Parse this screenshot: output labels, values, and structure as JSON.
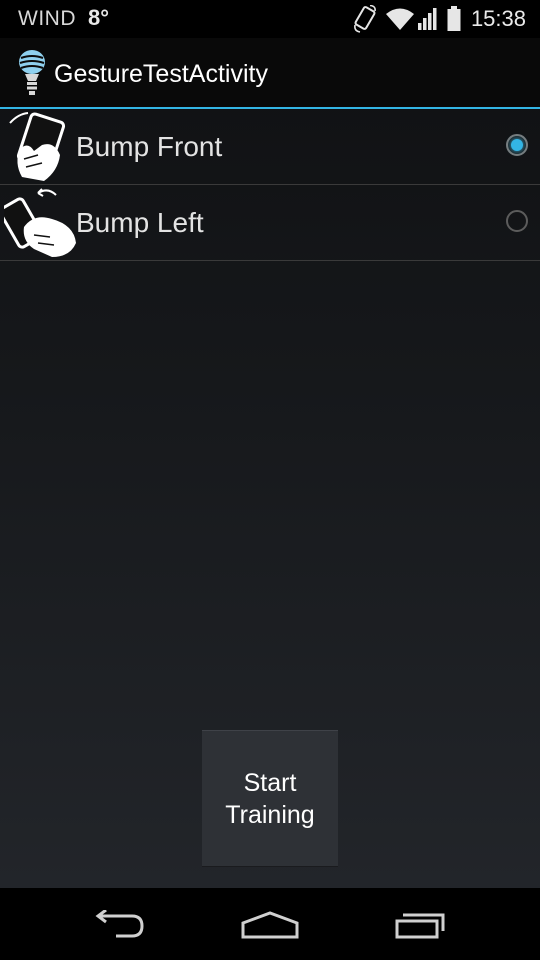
{
  "status_bar": {
    "carrier": "WIND",
    "temperature": "8°",
    "time": "15:38",
    "icons": [
      "screen-rotation-icon",
      "wifi-icon",
      "cell-signal-icon",
      "battery-icon"
    ]
  },
  "action_bar": {
    "title": "GestureTestActivity",
    "icon": "lightbulb-app-icon"
  },
  "gestures": [
    {
      "label": "Bump Front",
      "icon": "bump-front-icon",
      "selected": true
    },
    {
      "label": "Bump Left",
      "icon": "bump-left-icon",
      "selected": false
    }
  ],
  "start_button": {
    "line1": "Start",
    "line2": "Training"
  },
  "nav_bar": {
    "buttons": [
      "back-icon",
      "home-icon",
      "recent-apps-icon"
    ]
  },
  "colors": {
    "accent": "#33b5e5",
    "status_bar_bg": "#000000",
    "action_bar_bg": "#090909"
  }
}
